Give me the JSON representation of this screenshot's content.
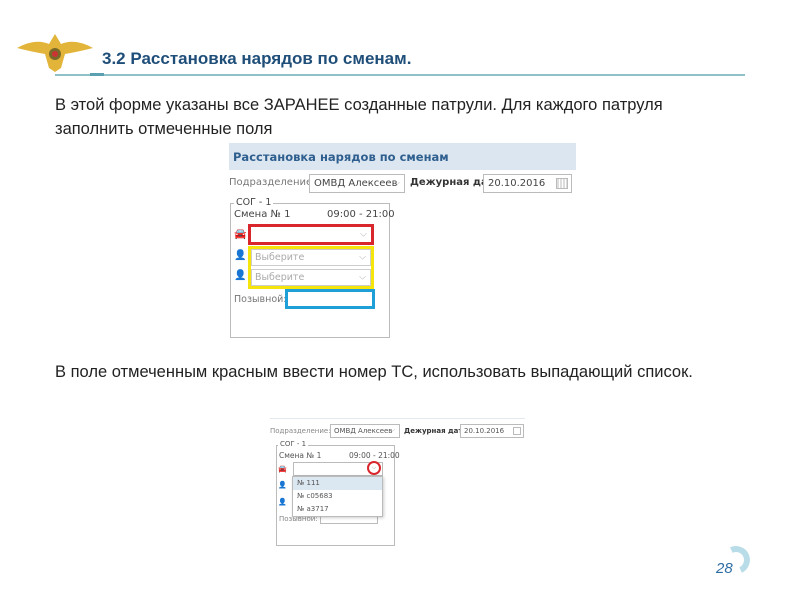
{
  "slide": {
    "title": "3.2 Расстановка нарядов по сменам.",
    "para1": "В этой форме указаны все ЗАРАНЕЕ созданные патрули. Для каждого патруля заполнить отмеченные поля",
    "para2": "В поле отмеченным красным ввести номер ТС, использовать выпадающий список.",
    "page_number": "28"
  },
  "form1": {
    "header": "Расстановка нарядов по сменам",
    "unit_label": "Подразделение:",
    "unit_value": "ОМВД Алексеев",
    "date_label": "Дежурная дата:",
    "date_value": "20.10.2016",
    "group": "СОГ - 1",
    "shift": "Смена № 1",
    "time": "09:00 - 21:00",
    "placeholder1": "Выберите",
    "placeholder2": "Выберите",
    "callsign_label": "Позывной:"
  },
  "form2": {
    "unit_label": "Подразделение:",
    "unit_value": "ОМВД Алексеев",
    "date_label": "Дежурная дата:",
    "date_value": "20.10.2016",
    "group": "СОГ - 1",
    "shift": "Смена № 1",
    "time": "09:00 - 21:00",
    "callsign_label": "Позывной:",
    "options": [
      "№ 111",
      "№ с05683",
      "№ а3717"
    ]
  },
  "colors": {
    "highlight_vehicle": "#d9262c",
    "highlight_staff": "#f5e50c",
    "highlight_callsign": "#1e9fd8",
    "header_bg": "#dce6f0",
    "title": "#1f4e79"
  },
  "icons": {
    "logo": "double-headed-eagle-emblem",
    "vehicle": "car-icon",
    "person": "person-icon",
    "calendar": "calendar-icon"
  }
}
